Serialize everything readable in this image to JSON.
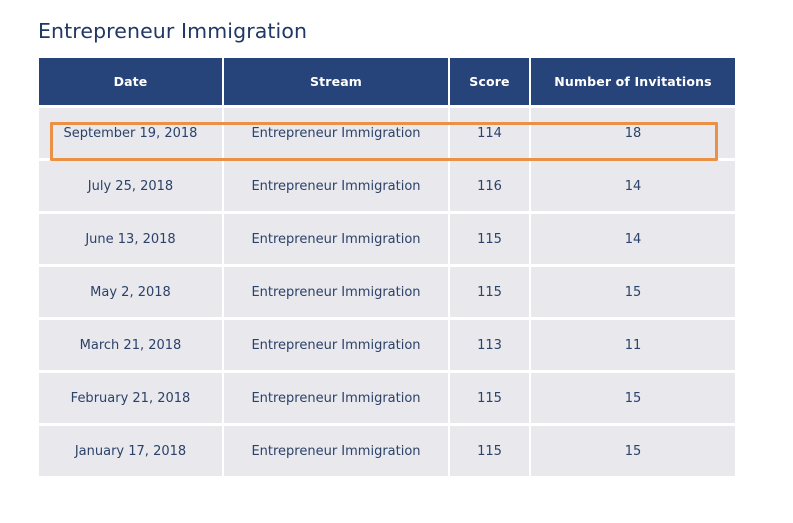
{
  "page": {
    "title": "Entrepreneur Immigration",
    "background_color": "#ffffff"
  },
  "colors": {
    "header_navy": "#26447a",
    "cell_gray": "#e8e8ed",
    "text_navy": "#2c4268",
    "title_navy": "#1f3864",
    "highlight_orange": "#ea9146"
  },
  "table": {
    "columns": [
      {
        "key": "date",
        "label": "Date"
      },
      {
        "key": "stream",
        "label": "Stream"
      },
      {
        "key": "score",
        "label": "Score"
      },
      {
        "key": "invites",
        "label": "Number of Invitations"
      }
    ],
    "rows": [
      {
        "date": "September 19, 2018",
        "stream": "Entrepreneur Immigration",
        "score": "114",
        "invites": "18",
        "highlighted": true
      },
      {
        "date": "July 25, 2018",
        "stream": "Entrepreneur Immigration",
        "score": "116",
        "invites": "14",
        "highlighted": false
      },
      {
        "date": "June 13, 2018",
        "stream": "Entrepreneur Immigration",
        "score": "115",
        "invites": "14",
        "highlighted": false
      },
      {
        "date": "May 2, 2018",
        "stream": "Entrepreneur Immigration",
        "score": "115",
        "invites": "15",
        "highlighted": false
      },
      {
        "date": "March 21, 2018",
        "stream": "Entrepreneur Immigration",
        "score": "113",
        "invites": "11",
        "highlighted": false
      },
      {
        "date": "February 21, 2018",
        "stream": "Entrepreneur Immigration",
        "score": "115",
        "invites": "15",
        "highlighted": false
      },
      {
        "date": "January 17, 2018",
        "stream": "Entrepreneur Immigration",
        "score": "115",
        "invites": "15",
        "highlighted": false
      }
    ]
  }
}
